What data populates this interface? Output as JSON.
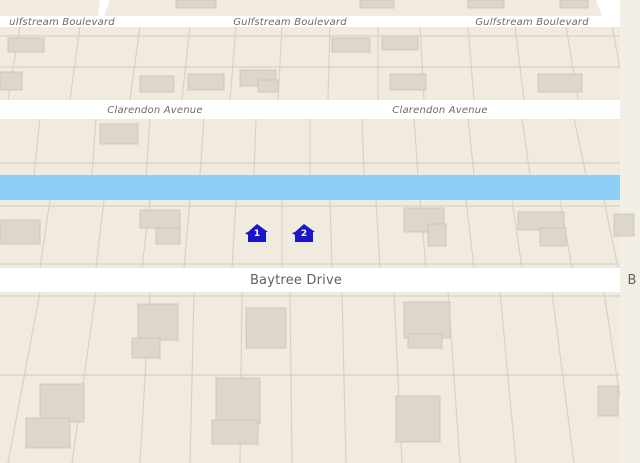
{
  "map": {
    "colors": {
      "land": "#f1ebdf",
      "road": "#ffffff",
      "lot_line": "#d8d1c4",
      "water": "#8ecdf6",
      "building": "#ddd6ca",
      "building_edge": "#cfc7b9",
      "marker": "#1818c8"
    },
    "streets": [
      {
        "name": "Gulfstream Boulevard",
        "display": "Gulfstream Boulevard"
      },
      {
        "name": "Clarendon Avenue",
        "display": "Clarendon Avenue"
      },
      {
        "name": "Baytree Drive",
        "display": "Baytree Drive"
      }
    ],
    "street_labels": [
      {
        "text": "Gulfstream Boulevard",
        "fragment": "ulfstream Boulevard"
      },
      {
        "text": "Gulfstream Boulevard",
        "fragment": "Gulfstream Boulevard"
      },
      {
        "text": "Gulfstream Boulevard",
        "fragment": "Gulfstream Boulevard"
      },
      {
        "text": "Clarendon Avenue",
        "fragment": "Clarendon Avenue"
      },
      {
        "text": "Clarendon Avenue",
        "fragment": "Clarendon Avenue"
      },
      {
        "text": "Baytree Drive",
        "fragment": "Baytree Drive"
      },
      {
        "text": "Baytree Drive",
        "fragment": "B"
      }
    ],
    "markers": [
      {
        "label": "1",
        "icon": "house-icon"
      },
      {
        "label": "2",
        "icon": "house-icon"
      }
    ]
  }
}
